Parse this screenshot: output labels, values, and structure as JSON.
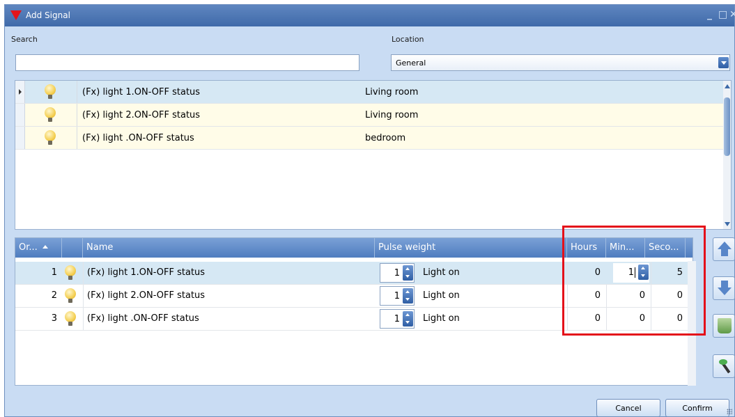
{
  "window": {
    "title": "Add Signal",
    "accent_color": "#e4101a"
  },
  "search": {
    "label": "Search",
    "value": "",
    "placeholder": ""
  },
  "location": {
    "label": "Location",
    "selected": "General"
  },
  "signals": [
    {
      "name": "(Fx) light 1.ON-OFF status",
      "location": "Living room",
      "icon": "light-bulb-icon"
    },
    {
      "name": "(Fx) light 2.ON-OFF status",
      "location": "Living room",
      "icon": "light-bulb-icon"
    },
    {
      "name": "(Fx) light .ON-OFF status",
      "location": "bedroom",
      "icon": "light-bulb-icon"
    }
  ],
  "selected": {
    "columns": {
      "order": "Or...",
      "name": "Name",
      "pulse_weight": "Pulse weight",
      "hours": "Hours",
      "minutes": "Min...",
      "seconds": "Seco..."
    },
    "rows": [
      {
        "order": "1",
        "name": "(Fx) light 1.ON-OFF status",
        "pulse_value": "1",
        "pulse_label": "Light on",
        "hours": "0",
        "minutes": "1",
        "seconds": "5"
      },
      {
        "order": "2",
        "name": "(Fx) light 2.ON-OFF status",
        "pulse_value": "1",
        "pulse_label": "Light on",
        "hours": "0",
        "minutes": "0",
        "seconds": "0"
      },
      {
        "order": "3",
        "name": "(Fx) light .ON-OFF status",
        "pulse_value": "1",
        "pulse_label": "Light on",
        "hours": "0",
        "minutes": "0",
        "seconds": "0"
      }
    ]
  },
  "side_buttons": [
    "move-up-icon",
    "move-down-icon",
    "trash-icon",
    "wand-icon"
  ],
  "footer": {
    "cancel": "Cancel",
    "confirm": "Confirm"
  }
}
